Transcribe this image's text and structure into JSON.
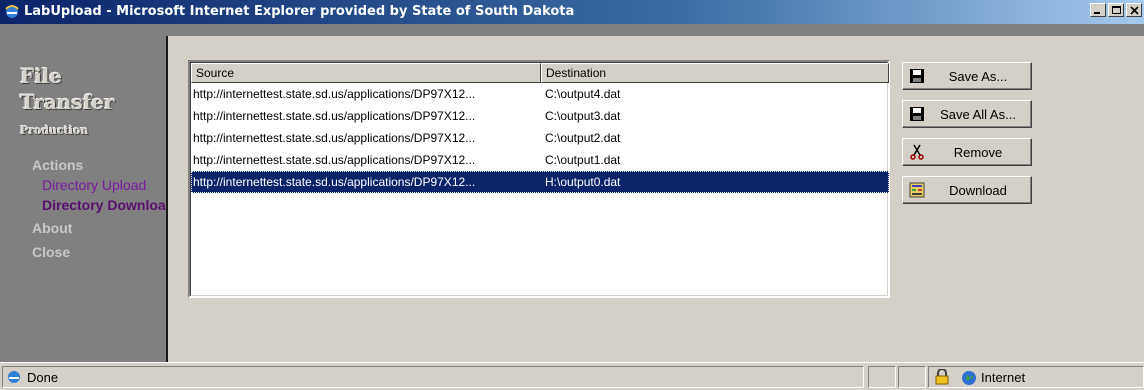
{
  "window": {
    "title": "LabUpload - Microsoft Internet Explorer provided by State of South Dakota",
    "buttons": [
      "minimize",
      "maximize",
      "close"
    ]
  },
  "sidebar": {
    "brand_line1": "File",
    "brand_line2": "Transfer",
    "brand_line3": "Production",
    "actions_label": "Actions",
    "directory_upload": "Directory Upload",
    "directory_download": "Directory Downloa",
    "about": "About",
    "close": "Close"
  },
  "list": {
    "columns": [
      "Source",
      "Destination"
    ],
    "rows": [
      {
        "source": "http://internettest.state.sd.us/applications/DP97X12...",
        "destination": "C:\\output4.dat",
        "selected": false
      },
      {
        "source": "http://internettest.state.sd.us/applications/DP97X12...",
        "destination": "C:\\output3.dat",
        "selected": false
      },
      {
        "source": "http://internettest.state.sd.us/applications/DP97X12...",
        "destination": "C:\\output2.dat",
        "selected": false
      },
      {
        "source": "http://internettest.state.sd.us/applications/DP97X12...",
        "destination": "C:\\output1.dat",
        "selected": false
      },
      {
        "source": "http://internettest.state.sd.us/applications/DP97X12...",
        "destination": "H:\\output0.dat",
        "selected": true
      }
    ]
  },
  "actions": {
    "save_as": "Save As...",
    "save_all_as": "Save All As...",
    "remove": "Remove",
    "download": "Download"
  },
  "status": {
    "text": "Done",
    "zone": "Internet"
  },
  "icons": {
    "ie": "ie-icon",
    "save": "floppy-disk-icon",
    "remove": "scissors-icon",
    "download": "download-icon",
    "lock": "lock-icon",
    "zone": "globe-icon"
  },
  "colors": {
    "titlebar_start": "#0a246a",
    "selection": "#0a246a",
    "link": "#7a1aa0",
    "panel_bg": "#808080",
    "dialog_bg": "#d4d0c8"
  }
}
